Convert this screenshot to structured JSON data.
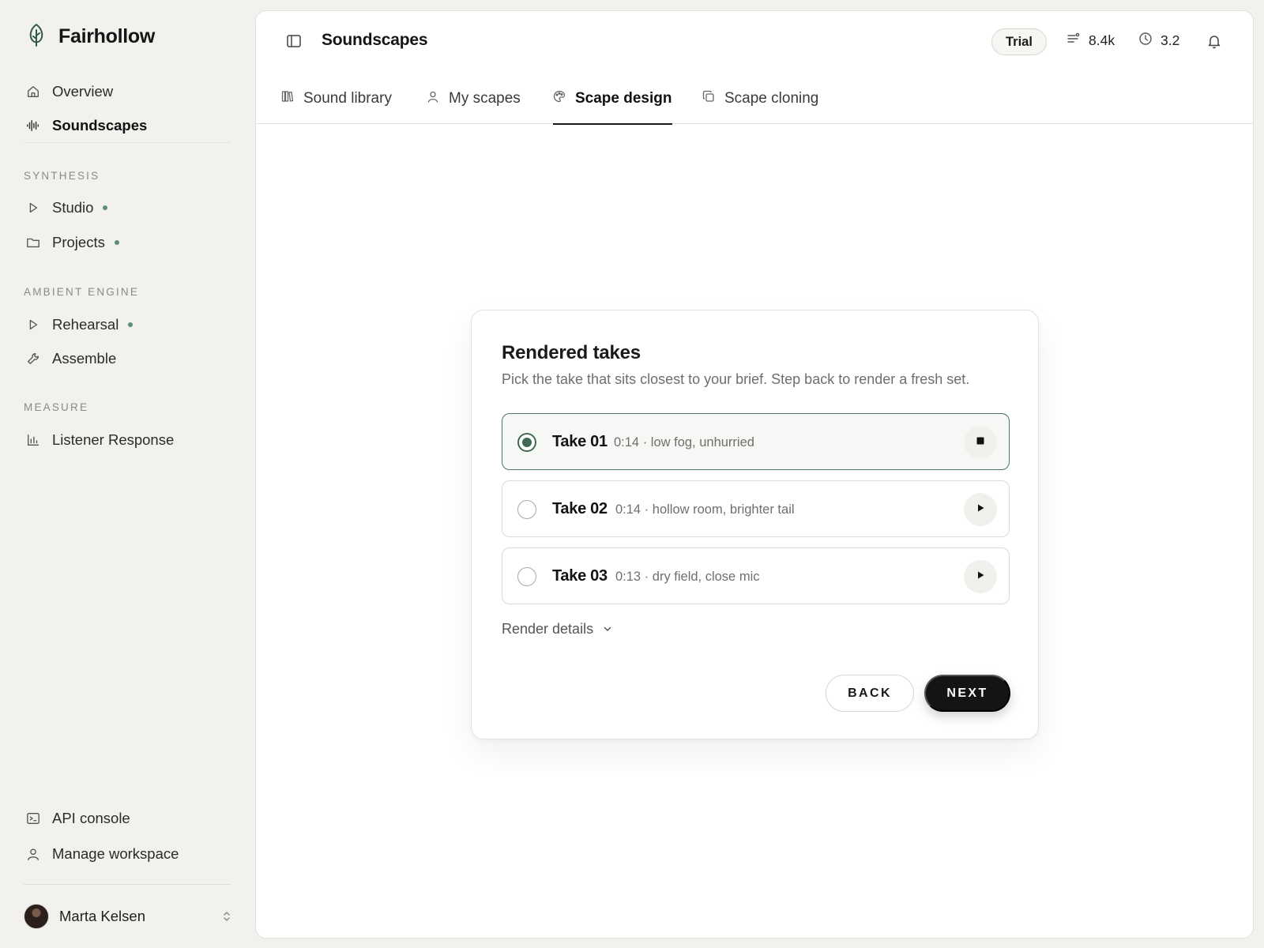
{
  "brand": {
    "name": "Fairhollow",
    "icon": "leaf-icon"
  },
  "sidebar": {
    "top_items": [
      {
        "label": "Overview",
        "icon": "home-icon",
        "active": false
      },
      {
        "label": "Soundscapes",
        "icon": "waveform-icon",
        "active": true
      }
    ],
    "sections": [
      {
        "label": "SYNTHESIS",
        "items": [
          {
            "label": "Studio",
            "icon": "play-icon",
            "dot": true
          },
          {
            "label": "Projects",
            "icon": "folder-icon",
            "dot": true
          }
        ]
      },
      {
        "label": "AMBIENT ENGINE",
        "items": [
          {
            "label": "Rehearsal",
            "icon": "play-icon",
            "dot": true
          },
          {
            "label": "Assemble",
            "icon": "wrench-icon",
            "dot": false
          }
        ]
      },
      {
        "label": "MEASURE",
        "items": [
          {
            "label": "Listener Response",
            "icon": "bar-chart-icon",
            "dot": false
          }
        ]
      }
    ],
    "bottom_items": [
      {
        "label": "API console",
        "icon": "terminal-icon"
      },
      {
        "label": "Manage workspace",
        "icon": "user-icon"
      }
    ],
    "user": {
      "name": "Marta Kelsen"
    },
    "dot_color": "#5e8e73"
  },
  "header": {
    "title": "Soundscapes",
    "badge": "Trial",
    "stats": [
      {
        "icon": "sliders-icon",
        "value": "8.4k"
      },
      {
        "icon": "clock-icon",
        "value": "3.2"
      }
    ]
  },
  "tabs": [
    {
      "label": "Sound library",
      "icon": "library-icon",
      "active": false
    },
    {
      "label": "My scapes",
      "icon": "user-icon",
      "active": false
    },
    {
      "label": "Scape design",
      "icon": "palette-icon",
      "active": true
    },
    {
      "label": "Scape cloning",
      "icon": "copy-icon",
      "active": false
    }
  ],
  "card": {
    "title": "Rendered takes",
    "subtitle": "Pick the take that sits closest to your brief. Step back to render a fresh set.",
    "takes": [
      {
        "name": "Take 01",
        "desc": "0:14 · low fog, unhurried",
        "selected": true,
        "playing": true
      },
      {
        "name": "Take 02",
        "desc": "0:14 · hollow room, brighter tail",
        "selected": false,
        "playing": false
      },
      {
        "name": "Take 03",
        "desc": "0:13 · dry field, close mic",
        "selected": false,
        "playing": false
      }
    ],
    "details_label": "Render details",
    "back_label": "BACK",
    "next_label": "NEXT"
  },
  "colors": {
    "accent": "#3f6a56",
    "primary_button": "#141414"
  }
}
